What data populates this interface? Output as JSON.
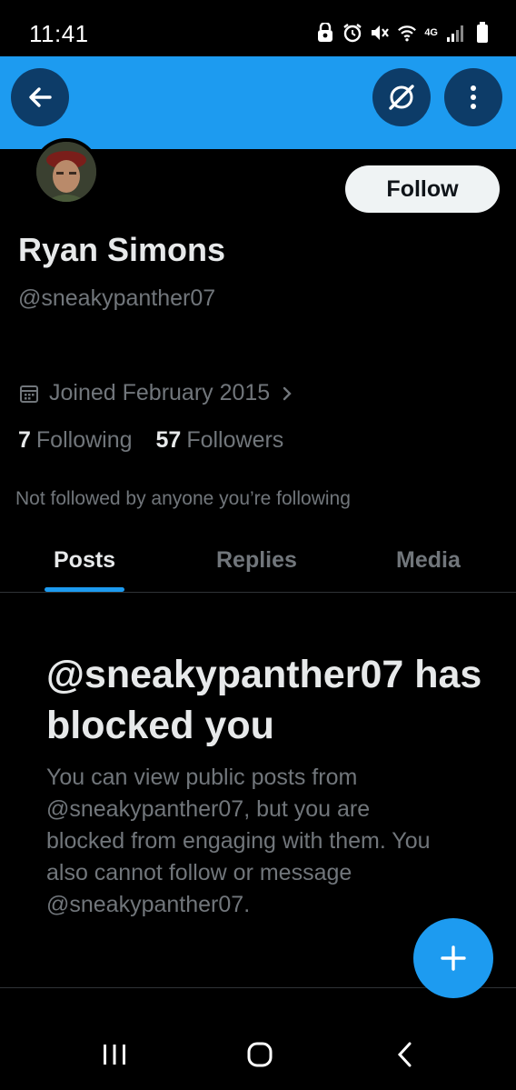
{
  "status_bar": {
    "time": "11:41",
    "network_label": "4G",
    "icons": [
      "lock-icon",
      "alarm-icon",
      "mute-icon",
      "wifi-icon",
      "signal-icon",
      "battery-icon"
    ]
  },
  "header": {
    "banner_color": "#1d9bf0",
    "back_icon": "arrow-left-icon",
    "grok_icon": "grok-icon",
    "more_icon": "more-vertical-icon"
  },
  "profile": {
    "display_name": "Ryan Simons",
    "handle": "@sneakypanther07",
    "follow_label": "Follow",
    "joined": "Joined February 2015",
    "following_count": "7",
    "following_label": "Following",
    "followers_count": "57",
    "followers_label": "Followers",
    "mutuals_note": "Not followed by anyone you’re following"
  },
  "tabs": [
    {
      "label": "Posts",
      "active": true
    },
    {
      "label": "Replies",
      "active": false
    },
    {
      "label": "Media",
      "active": false
    }
  ],
  "blocked": {
    "title": "@sneakypanther07 has blocked you",
    "description": "You can view public posts from @sneakypanther07, but you are blocked from engaging with them. You also cannot follow or message @sneakypanther07."
  },
  "fab": {
    "icon": "plus-icon"
  },
  "nav_bar": {
    "buttons": [
      "recents-icon",
      "home-icon",
      "back-chevron-icon"
    ]
  },
  "colors": {
    "accent": "#1d9bf0",
    "background": "#000000",
    "text_primary": "#e7e9ea",
    "text_secondary": "#71767b"
  }
}
